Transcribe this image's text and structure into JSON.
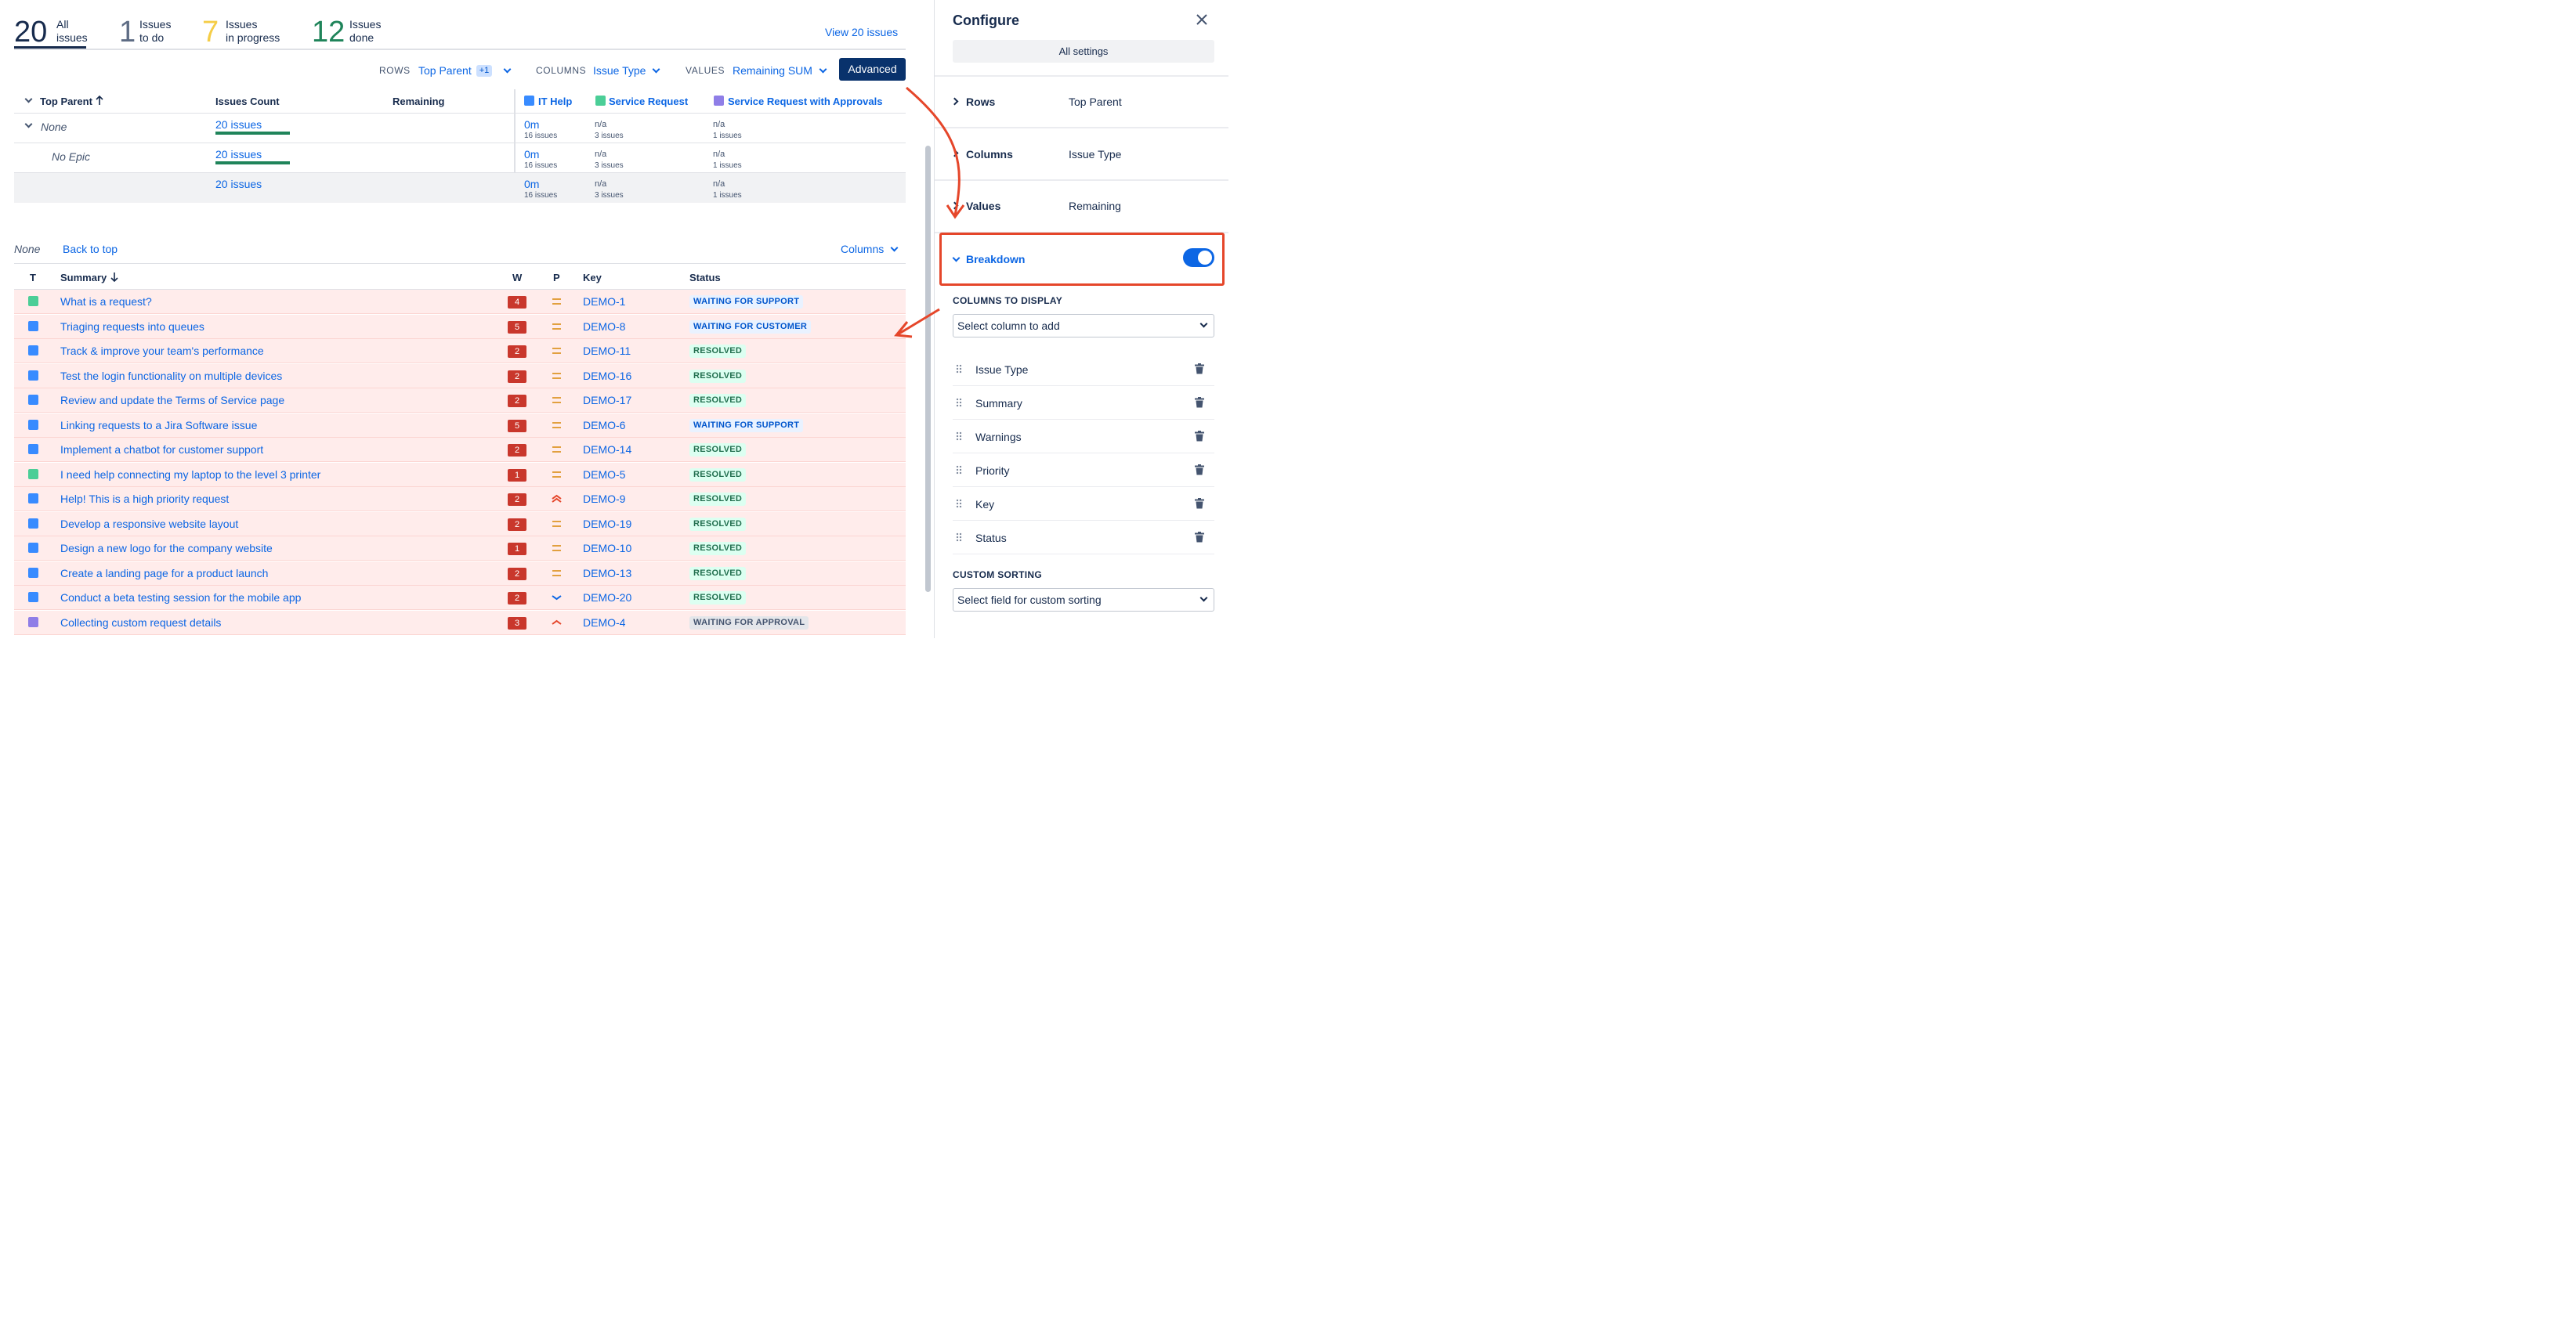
{
  "stats": {
    "all": {
      "num": "20",
      "l1": "All",
      "l2": "issues"
    },
    "todo": {
      "num": "1",
      "l1": "Issues",
      "l2": "to do"
    },
    "progress": {
      "num": "7",
      "l1": "Issues",
      "l2": "in progress"
    },
    "done": {
      "num": "12",
      "l1": "Issues",
      "l2": "done"
    },
    "view_link": "View 20 issues"
  },
  "controls": {
    "rows_label": "ROWS",
    "rows_value": "Top Parent",
    "rows_badge": "+1",
    "columns_label": "COLUMNS",
    "columns_value": "Issue Type",
    "values_label": "VALUES",
    "values_value": "Remaining SUM",
    "advanced": "Advanced"
  },
  "pivot": {
    "headers": {
      "top_parent": "Top Parent",
      "issues_count": "Issues Count",
      "remaining": "Remaining",
      "it_help": "IT Help",
      "service_request": "Service Request",
      "service_request_approvals": "Service Request with Approvals"
    },
    "rows": [
      {
        "label": "None",
        "count": "20 issues",
        "it_val": "0m",
        "it_sub": "16 issues",
        "sr_val": "n/a",
        "sr_sub": "3 issues",
        "ap_val": "n/a",
        "ap_sub": "1 issues"
      },
      {
        "label": "No Epic",
        "count": "20 issues",
        "it_val": "0m",
        "it_sub": "16 issues",
        "sr_val": "n/a",
        "sr_sub": "3 issues",
        "ap_val": "n/a",
        "ap_sub": "1 issues"
      },
      {
        "label": "",
        "count": "20 issues",
        "it_val": "0m",
        "it_sub": "16 issues",
        "sr_val": "n/a",
        "sr_sub": "3 issues",
        "ap_val": "n/a",
        "ap_sub": "1 issues"
      }
    ]
  },
  "list": {
    "group": "None",
    "back_to_top": "Back to top",
    "columns_btn": "Columns",
    "headers": {
      "t": "T",
      "summary": "Summary",
      "w": "W",
      "p": "P",
      "key": "Key",
      "status": "Status"
    },
    "issues": [
      {
        "type": "sr",
        "summary": "What is a request?",
        "w": "4",
        "p": "medium",
        "key": "DEMO-1",
        "status": "WAITING FOR SUPPORT",
        "st": "blue"
      },
      {
        "type": "it",
        "summary": "Triaging requests into queues",
        "w": "5",
        "p": "medium",
        "key": "DEMO-8",
        "status": "WAITING FOR CUSTOMER",
        "st": "blue"
      },
      {
        "type": "it",
        "summary": "Track & improve your team's performance",
        "w": "2",
        "p": "medium",
        "key": "DEMO-11",
        "status": "RESOLVED",
        "st": "green"
      },
      {
        "type": "it",
        "summary": "Test the login functionality on multiple devices",
        "w": "2",
        "p": "medium",
        "key": "DEMO-16",
        "status": "RESOLVED",
        "st": "green"
      },
      {
        "type": "it",
        "summary": "Review and update the Terms of Service page",
        "w": "2",
        "p": "medium",
        "key": "DEMO-17",
        "status": "RESOLVED",
        "st": "green"
      },
      {
        "type": "it",
        "summary": "Linking requests to a Jira Software issue",
        "w": "5",
        "p": "medium",
        "key": "DEMO-6",
        "status": "WAITING FOR SUPPORT",
        "st": "blue"
      },
      {
        "type": "it",
        "summary": "Implement a chatbot for customer support",
        "w": "2",
        "p": "medium",
        "key": "DEMO-14",
        "status": "RESOLVED",
        "st": "green"
      },
      {
        "type": "sr",
        "summary": "I need help connecting my laptop to the level 3 printer",
        "w": "1",
        "p": "medium",
        "key": "DEMO-5",
        "status": "RESOLVED",
        "st": "green"
      },
      {
        "type": "it",
        "summary": "Help! This is a high priority request",
        "w": "2",
        "p": "highest",
        "key": "DEMO-9",
        "status": "RESOLVED",
        "st": "green"
      },
      {
        "type": "it",
        "summary": "Develop a responsive website layout",
        "w": "2",
        "p": "medium",
        "key": "DEMO-19",
        "status": "RESOLVED",
        "st": "green"
      },
      {
        "type": "it",
        "summary": "Design a new logo for the company website",
        "w": "1",
        "p": "medium",
        "key": "DEMO-10",
        "status": "RESOLVED",
        "st": "green"
      },
      {
        "type": "it",
        "summary": "Create a landing page for a product launch",
        "w": "2",
        "p": "medium",
        "key": "DEMO-13",
        "status": "RESOLVED",
        "st": "green"
      },
      {
        "type": "it",
        "summary": "Conduct a beta testing session for the mobile app",
        "w": "2",
        "p": "low",
        "key": "DEMO-20",
        "status": "RESOLVED",
        "st": "green"
      },
      {
        "type": "ap",
        "summary": "Collecting custom request details",
        "w": "3",
        "p": "high",
        "key": "DEMO-4",
        "status": "WAITING FOR APPROVAL",
        "st": "grey"
      }
    ]
  },
  "panel": {
    "title": "Configure",
    "all_settings": "All settings",
    "rows_label": "Rows",
    "rows_value": "Top Parent",
    "columns_label": "Columns",
    "columns_value": "Issue Type",
    "values_label": "Values",
    "values_value": "Remaining",
    "breakdown_label": "Breakdown",
    "columns_to_display": "COLUMNS TO DISPLAY",
    "select_column": "Select column to add",
    "display_columns": [
      "Issue Type",
      "Summary",
      "Warnings",
      "Priority",
      "Key",
      "Status"
    ],
    "custom_sorting": "CUSTOM SORTING",
    "select_sort": "Select field for custom sorting"
  },
  "colors": {
    "accent": "#0c66e4",
    "annotation": "#e5462a",
    "todo": "#5e6c84",
    "progress": "#f5cd47",
    "done": "#1f845a"
  }
}
